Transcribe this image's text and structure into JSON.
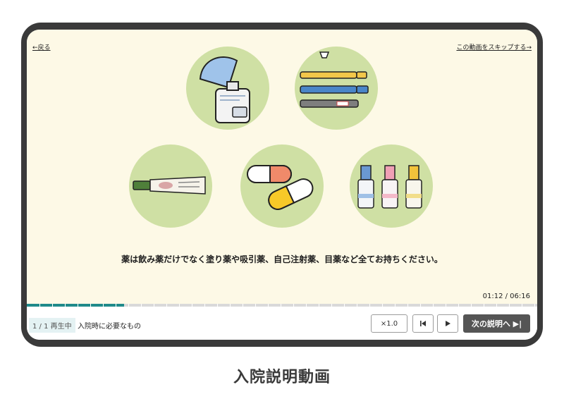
{
  "nav": {
    "back_label": "←戻る",
    "skip_label": "この動画をスキップする→"
  },
  "illustrations": [
    {
      "name": "inhaler-icon"
    },
    {
      "name": "insulin-pens-icon"
    },
    {
      "name": "ointment-tube-icon"
    },
    {
      "name": "capsules-icon"
    },
    {
      "name": "eye-drops-icon"
    }
  ],
  "video": {
    "caption": "薬は飲み薬だけでなく塗り薬や吸引薬、自己注射薬、目薬など全てお持ちください。",
    "time": "01:12 / 06:16",
    "progress_fraction": 0.19
  },
  "controls": {
    "status": "1 / 1 再生中",
    "title": "入院時に必要なもの",
    "speed_label": "×1.0",
    "prev_icon": "skip-back-icon",
    "play_icon": "play-icon",
    "next_label": "次の説明へ ▶|"
  },
  "page_caption": "入院説明動画",
  "colors": {
    "accent": "#1f8a8a",
    "circle": "#cfe0a4",
    "video_bg": "#fdf9e6"
  }
}
